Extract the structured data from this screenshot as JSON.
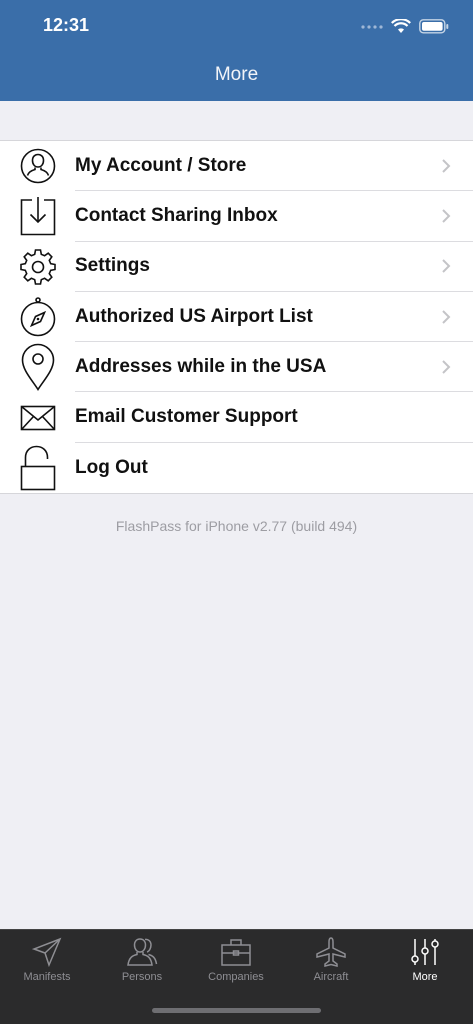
{
  "status_bar": {
    "time": "12:31"
  },
  "nav": {
    "title": "More"
  },
  "menu": {
    "items": [
      {
        "label": "My Account / Store",
        "icon": "person-circle-icon",
        "chevron": true
      },
      {
        "label": "Contact Sharing Inbox",
        "icon": "inbox-download-icon",
        "chevron": true
      },
      {
        "label": "Settings",
        "icon": "gear-icon",
        "chevron": true
      },
      {
        "label": "Authorized US Airport List",
        "icon": "compass-icon",
        "chevron": true
      },
      {
        "label": "Addresses while in the USA",
        "icon": "map-pin-icon",
        "chevron": true
      },
      {
        "label": "Email Customer Support",
        "icon": "envelope-icon",
        "chevron": false
      },
      {
        "label": "Log Out",
        "icon": "unlocked-padlock-icon",
        "chevron": false
      }
    ]
  },
  "footer": {
    "version": "FlashPass for iPhone v2.77 (build 494)"
  },
  "tabbar": {
    "tabs": [
      {
        "label": "Manifests",
        "icon": "paper-plane-icon",
        "active": false
      },
      {
        "label": "Persons",
        "icon": "persons-icon",
        "active": false
      },
      {
        "label": "Companies",
        "icon": "briefcase-icon",
        "active": false
      },
      {
        "label": "Aircraft",
        "icon": "airplane-icon",
        "active": false
      },
      {
        "label": "More",
        "icon": "sliders-icon",
        "active": true
      }
    ]
  },
  "colors": {
    "header": "#3a6ea9",
    "tabbar": "#2b2b2c",
    "background": "#efeff4"
  }
}
